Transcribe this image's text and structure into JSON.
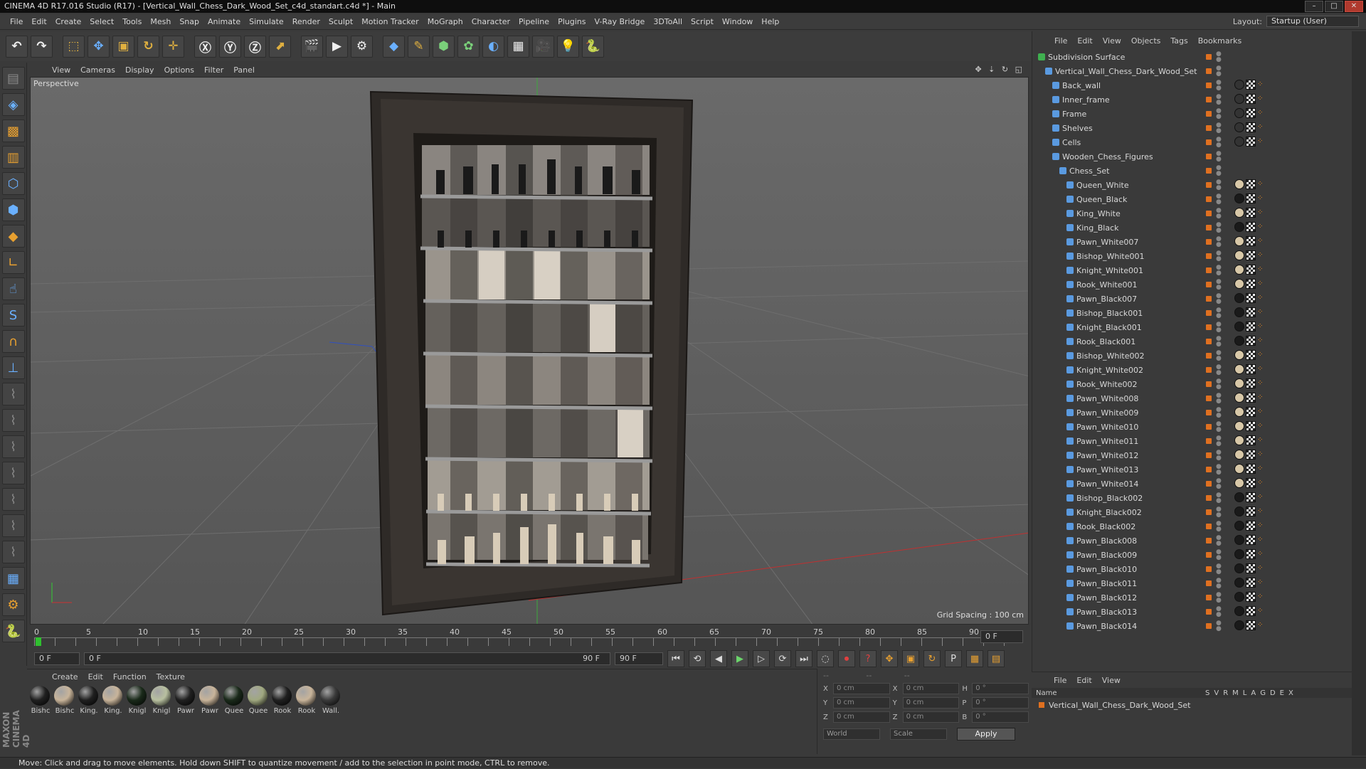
{
  "window": {
    "title": "CINEMA 4D R17.016 Studio (R17) - [Vertical_Wall_Chess_Dark_Wood_Set_c4d_standart.c4d *] - Main"
  },
  "menu": [
    "File",
    "Edit",
    "Create",
    "Select",
    "Tools",
    "Mesh",
    "Snap",
    "Animate",
    "Simulate",
    "Render",
    "Sculpt",
    "Motion Tracker",
    "MoGraph",
    "Character",
    "Pipeline",
    "Plugins",
    "V-Ray Bridge",
    "3DToAll",
    "Script",
    "Window",
    "Help"
  ],
  "layout": {
    "label": "Layout:",
    "value": "Startup (User)"
  },
  "viewport": {
    "menu": [
      "View",
      "Cameras",
      "Display",
      "Options",
      "Filter",
      "Panel"
    ],
    "label": "Perspective",
    "grid_spacing": "Grid Spacing : 100 cm"
  },
  "timeline": {
    "ticks": [
      "0",
      "5",
      "10",
      "15",
      "20",
      "25",
      "30",
      "35",
      "40",
      "45",
      "50",
      "55",
      "60",
      "65",
      "70",
      "75",
      "80",
      "85",
      "90"
    ],
    "current": "0 F",
    "start": "0 F",
    "range_start": "0 F",
    "range_end": "90 F",
    "end": "90 F"
  },
  "materials": {
    "menu": [
      "Create",
      "Edit",
      "Function",
      "Texture"
    ],
    "items": [
      {
        "label": "Bishc",
        "color": "#202020"
      },
      {
        "label": "Bishc",
        "color": "#c8b49a"
      },
      {
        "label": "King.",
        "color": "#202020"
      },
      {
        "label": "King.",
        "color": "#c8b49a"
      },
      {
        "label": "Knigl",
        "color": "#1a2a1a"
      },
      {
        "label": "Knigl",
        "color": "#b8c0a0"
      },
      {
        "label": "Pawr",
        "color": "#202020"
      },
      {
        "label": "Pawr",
        "color": "#c8b49a"
      },
      {
        "label": "Quee",
        "color": "#1a2a1a"
      },
      {
        "label": "Quee",
        "color": "#a0a880"
      },
      {
        "label": "Rook",
        "color": "#202020"
      },
      {
        "label": "Rook",
        "color": "#c8b49a"
      },
      {
        "label": "Wall.",
        "color": "#3a3a3a"
      }
    ]
  },
  "coords": {
    "x1": "0 cm",
    "x2": "0 cm",
    "h": "0 °",
    "y1": "0 cm",
    "y2": "0 cm",
    "p": "0 °",
    "z1": "0 cm",
    "z2": "0 cm",
    "b": "0 °",
    "world": "World",
    "scale": "Scale",
    "apply": "Apply"
  },
  "objects": {
    "menu": [
      "File",
      "Edit",
      "View",
      "Objects",
      "Tags",
      "Bookmarks"
    ],
    "items": [
      {
        "name": "Subdivision Surface",
        "indent": 0
      },
      {
        "name": "Vertical_Wall_Chess_Dark_Wood_Set",
        "indent": 1
      },
      {
        "name": "Back_wall",
        "indent": 2
      },
      {
        "name": "Inner_frame",
        "indent": 2
      },
      {
        "name": "Frame",
        "indent": 2
      },
      {
        "name": "Shelves",
        "indent": 2
      },
      {
        "name": "Cells",
        "indent": 2
      },
      {
        "name": "Wooden_Chess_Figures",
        "indent": 2
      },
      {
        "name": "Chess_Set",
        "indent": 3
      },
      {
        "name": "Queen_White",
        "indent": 4
      },
      {
        "name": "Queen_Black",
        "indent": 4
      },
      {
        "name": "King_White",
        "indent": 4
      },
      {
        "name": "King_Black",
        "indent": 4
      },
      {
        "name": "Pawn_White007",
        "indent": 4
      },
      {
        "name": "Bishop_White001",
        "indent": 4
      },
      {
        "name": "Knight_White001",
        "indent": 4
      },
      {
        "name": "Rook_White001",
        "indent": 4
      },
      {
        "name": "Pawn_Black007",
        "indent": 4
      },
      {
        "name": "Bishop_Black001",
        "indent": 4
      },
      {
        "name": "Knight_Black001",
        "indent": 4
      },
      {
        "name": "Rook_Black001",
        "indent": 4
      },
      {
        "name": "Bishop_White002",
        "indent": 4
      },
      {
        "name": "Knight_White002",
        "indent": 4
      },
      {
        "name": "Rook_White002",
        "indent": 4
      },
      {
        "name": "Pawn_White008",
        "indent": 4
      },
      {
        "name": "Pawn_White009",
        "indent": 4
      },
      {
        "name": "Pawn_White010",
        "indent": 4
      },
      {
        "name": "Pawn_White011",
        "indent": 4
      },
      {
        "name": "Pawn_White012",
        "indent": 4
      },
      {
        "name": "Pawn_White013",
        "indent": 4
      },
      {
        "name": "Pawn_White014",
        "indent": 4
      },
      {
        "name": "Bishop_Black002",
        "indent": 4
      },
      {
        "name": "Knight_Black002",
        "indent": 4
      },
      {
        "name": "Rook_Black002",
        "indent": 4
      },
      {
        "name": "Pawn_Black008",
        "indent": 4
      },
      {
        "name": "Pawn_Black009",
        "indent": 4
      },
      {
        "name": "Pawn_Black010",
        "indent": 4
      },
      {
        "name": "Pawn_Black011",
        "indent": 4
      },
      {
        "name": "Pawn_Black012",
        "indent": 4
      },
      {
        "name": "Pawn_Black013",
        "indent": 4
      },
      {
        "name": "Pawn_Black014",
        "indent": 4
      }
    ]
  },
  "attributes": {
    "menu": [
      "File",
      "Edit",
      "View"
    ],
    "header_name": "Name",
    "header_cols": [
      "S",
      "V",
      "R",
      "M",
      "L",
      "A",
      "G",
      "D",
      "E",
      "X"
    ],
    "row": "Vertical_Wall_Chess_Dark_Wood_Set"
  },
  "status": "Move: Click and drag to move elements. Hold down SHIFT to quantize movement / add to the selection in point mode, CTRL to remove."
}
